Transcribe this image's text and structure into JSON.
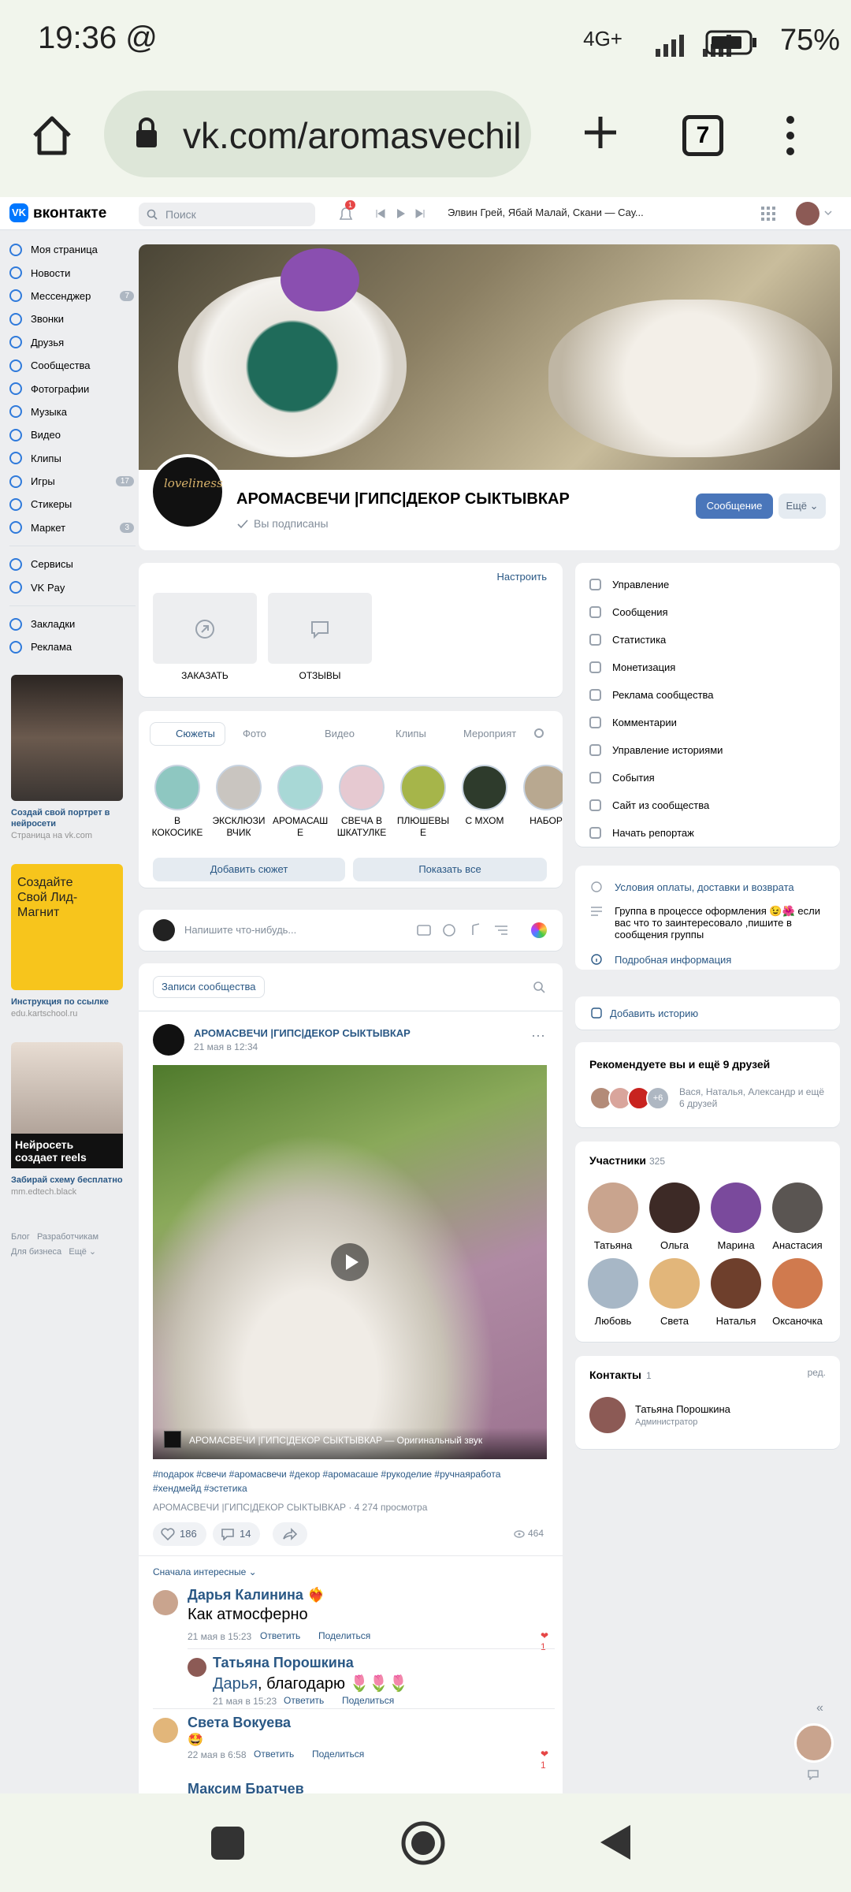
{
  "status": {
    "time": "19:36 @",
    "network": "4G+",
    "battery": "75%"
  },
  "browser": {
    "url": "vk.com/aromasvechil",
    "tabs_count": "7"
  },
  "vk": {
    "logo": "вконтакте",
    "search_placeholder": "Поиск",
    "notif_count": "1",
    "track": "Элвин Грей, Ябай Малай, Скани — Сау..."
  },
  "sidebar": {
    "items": [
      {
        "label": "Моя страница",
        "icon": "user-icon"
      },
      {
        "label": "Новости",
        "icon": "news-icon"
      },
      {
        "label": "Мессенджер",
        "icon": "chat-icon",
        "badge": "7"
      },
      {
        "label": "Звонки",
        "icon": "phone-icon"
      },
      {
        "label": "Друзья",
        "icon": "friends-icon"
      },
      {
        "label": "Сообщества",
        "icon": "groups-icon"
      },
      {
        "label": "Фотографии",
        "icon": "photo-icon"
      },
      {
        "label": "Музыка",
        "icon": "music-icon"
      },
      {
        "label": "Видео",
        "icon": "video-icon"
      },
      {
        "label": "Клипы",
        "icon": "clips-icon"
      },
      {
        "label": "Игры",
        "icon": "games-icon",
        "badge": "17"
      },
      {
        "label": "Стикеры",
        "icon": "sticker-icon"
      },
      {
        "label": "Маркет",
        "icon": "market-icon",
        "badge": "3"
      }
    ],
    "items2": [
      {
        "label": "Сервисы"
      },
      {
        "label": "VK Pay"
      }
    ],
    "items3": [
      {
        "label": "Закладки"
      },
      {
        "label": "Реклама"
      }
    ],
    "ads": [
      {
        "title": "Создай свой портрет в нейросети",
        "url": "Страница на vk.com",
        "color": "#3a3532"
      },
      {
        "title": "Инструкция по ссылке",
        "url": "edu.kartschool.ru",
        "color": "#f7c51c",
        "overlay": "Создайте Свой Лид-Магнит"
      },
      {
        "title": "Забирай схему бесплатно",
        "url": "mm.edtech.black",
        "color": "#b9b0a8",
        "overlay": "Нейросеть создает reels"
      }
    ],
    "footer": {
      "l1": "Блог",
      "l2": "Разработчикам",
      "l3": "Для бизнеса",
      "l4": "Ещё"
    }
  },
  "group": {
    "name": "АРОМАСВЕЧИ |ГИПС|ДЕКОР СЫКТЫВКАР",
    "subscribed": "Вы подписаны",
    "message_btn": "Сообщение",
    "more_btn": "Ещё",
    "avatar_text": "loveliness"
  },
  "links_block": {
    "configure": "Настроить",
    "items": [
      "ЗАКАЗАТЬ",
      "ОТЗЫВЫ"
    ]
  },
  "stories": {
    "tabs": [
      "Сюжеты",
      "Фото",
      "Видео",
      "Клипы",
      "Мероприят"
    ],
    "items": [
      "В КОКОСИКЕ",
      "ЭКСКЛЮЗИ ВЧИК",
      "АРОМАСАШ Е",
      "СВЕЧА В ШКАТУЛКЕ",
      "ПЛЮШЕВЫ Е",
      "С МХОМ",
      "НАБОР"
    ],
    "add": "Добавить сюжет",
    "show_all": "Показать все"
  },
  "composer": {
    "placeholder": "Напишите что-нибудь..."
  },
  "posts_header": {
    "title": "Записи сообщества"
  },
  "post": {
    "author": "АРОМАСВЕЧИ |ГИПС|ДЕКОР СЫКТЫВКАР",
    "date": "21 мая в 12:34",
    "video_caption": "АРОМАСВЕЧИ |ГИПС|ДЕКОР СЫКТЫВКАР — Оригинальный звук",
    "hashtags": "#подарок #свечи #аромасвечи #декор #аромасаше #рукоделие #ручнаяработа #хендмейд #эстетика",
    "views_line": "АРОМАСВЕЧИ |ГИПС|ДЕКОР СЫКТЫВКАР · 4 274 просмотра",
    "likes": "186",
    "comments": "14",
    "views": "464",
    "sort": "Сначала интересные"
  },
  "comments": [
    {
      "name": "Дарья Калинина",
      "text": "Как атмосферно",
      "meta": "21 мая в 15:23",
      "reply": "Ответить",
      "share": "Поделиться",
      "likes": "1"
    },
    {
      "name": "Татьяна Порошкина",
      "mention": "Дарья",
      "text": ", благодарю 🌷🌷🌷",
      "meta": "21 мая в 15:23",
      "reply": "Ответить",
      "share": "Поделиться"
    },
    {
      "name": "Света Вокуева",
      "text": "🤩",
      "meta": "22 мая в 6:58",
      "reply": "Ответить",
      "share": "Поделиться",
      "likes": "1"
    },
    {
      "name": "Максим Братчев"
    }
  ],
  "manage": {
    "items": [
      "Управление",
      "Сообщения",
      "Статистика",
      "Монетизация",
      "Реклама сообщества",
      "Комментарии",
      "Управление историями",
      "События",
      "Сайт из сообщества",
      "Начать репортаж"
    ]
  },
  "info": {
    "terms": "Условия оплаты, доставки и возврата",
    "desc": "Группа в процессе оформления 😉🌺 если вас что то заинтересовало ,пишите в сообщения группы",
    "more": "Подробная информация"
  },
  "add_story": "Добавить историю",
  "recommend": {
    "title": "Рекомендуете вы и ещё 9 друзей",
    "plus": "+6",
    "names": "Вася, Наталья, Александр и ещё 6 друзей"
  },
  "members": {
    "title": "Участники",
    "count": "325",
    "names": [
      "Татьяна",
      "Ольга",
      "Марина",
      "Анастасия",
      "Любовь",
      "Света",
      "Наталья",
      "Оксаночка"
    ]
  },
  "contacts": {
    "title": "Контакты",
    "count": "1",
    "edit": "ред.",
    "name": "Татьяна Порошкина",
    "role": "Администратор"
  }
}
